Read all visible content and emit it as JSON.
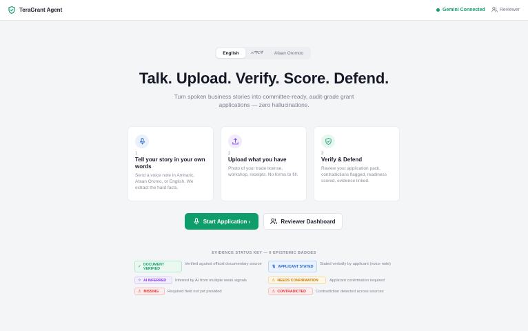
{
  "app": {
    "title": "TeraGrant Agent"
  },
  "header": {
    "status": "Gemini Connected",
    "reviewer": "Reviewer"
  },
  "languages": [
    {
      "label": "English",
      "active": true
    },
    {
      "label": "አማርኛ",
      "active": false
    },
    {
      "label": "Afaan Oromoo",
      "active": false
    }
  ],
  "hero": {
    "title": "Talk. Upload. Verify. Score. Defend.",
    "subtitle": "Turn spoken business stories into committee-ready, audit-grade grant applications — zero hallucinations."
  },
  "steps": [
    {
      "num": "1",
      "title": "Tell your story in your own words",
      "desc": "Send a voice note in Amharic, Afaan Oromo, or English. We extract the hard facts.",
      "icon": "microphone-icon"
    },
    {
      "num": "2",
      "title": "Upload what you have",
      "desc": "Photo of your trade license, workshop, receipts. No forms to fill.",
      "icon": "upload-icon"
    },
    {
      "num": "3",
      "title": "Verify & Defend",
      "desc": "Review your application pack, contradictions flagged, readiness scored, evidence linked.",
      "icon": "shield-check-icon"
    }
  ],
  "actions": {
    "start": "Start Application ›",
    "dashboard": "Reviewer Dashboard"
  },
  "key": {
    "title": "EVIDENCE STATUS KEY — 6 EPISTEMIC BADGES",
    "badges": [
      {
        "label": "DOCUMENT VERIFIED",
        "icon": "✓",
        "desc": "Verified against official documentary source",
        "color": "#0f9d6b"
      },
      {
        "label": "APPLICANT STATED",
        "icon": "🎙",
        "desc": "Stated verbally by applicant (voice note)",
        "color": "#2563c9"
      },
      {
        "label": "AI INFERRED",
        "icon": "✧",
        "desc": "Inferred by AI from multiple weak signals",
        "color": "#7c3aed"
      },
      {
        "label": "NEEDS CONFIRMATION",
        "icon": "⚠",
        "desc": "Applicant confirmation required",
        "color": "#c27c0e"
      },
      {
        "label": "MISSING",
        "icon": "⚠",
        "desc": "Required field not yet provided",
        "color": "#d93636"
      },
      {
        "label": "CONTRADICTED",
        "icon": "⚠",
        "desc": "Contradiction detected across sources",
        "color": "#d93636"
      }
    ]
  }
}
